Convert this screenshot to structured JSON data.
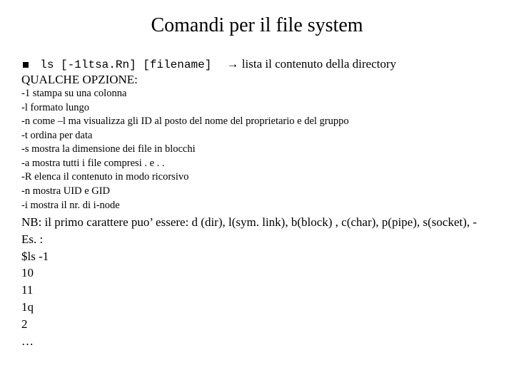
{
  "title": "Comandi per il file system",
  "command": {
    "code": "ls [-1ltsa.Rn] [filename]",
    "arrow": "→",
    "desc": "lista il contenuto della directory"
  },
  "options_heading": "QUALCHE OPZIONE:",
  "options": [
    "-1 stampa su una colonna",
    "-l formato lungo",
    "-n come –l ma visualizza gli ID al posto del nome del proprietario e del gruppo",
    "-t ordina per data",
    "-s mostra la dimensione dei file in blocchi",
    "-a mostra tutti i file compresi . e . .",
    "-R elenca il contenuto in modo ricorsivo",
    "-n mostra UID e GID",
    "-i mostra il nr. di i-node"
  ],
  "notes": [
    "NB: il primo carattere puo’ essere: d (dir), l(sym. link), b(block) , c(char), p(pipe), s(socket), -",
    "Es. :",
    "$ls -1",
    "10",
    "11",
    "1q",
    "2",
    "…"
  ]
}
